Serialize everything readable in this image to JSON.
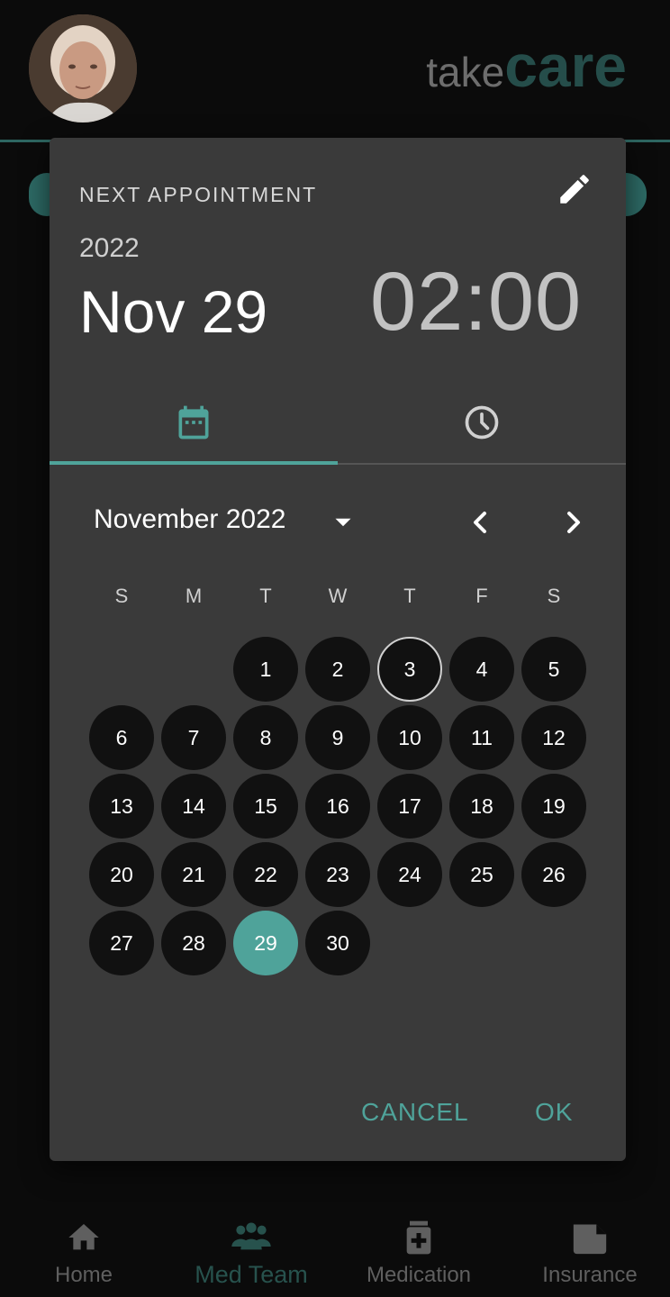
{
  "app": {
    "logo_take": "take",
    "logo_care": "care"
  },
  "dialog": {
    "title": "NEXT APPOINTMENT",
    "year": "2022",
    "date": "Nov 29",
    "time": "02:00",
    "month_label": "November 2022",
    "weekdays": [
      "S",
      "M",
      "T",
      "W",
      "T",
      "F",
      "S"
    ],
    "first_weekday_index": 2,
    "days_in_month": 30,
    "today": 3,
    "selected": 29,
    "cancel_label": "CANCEL",
    "ok_label": "OK"
  },
  "bottom_nav": {
    "items": [
      {
        "label": "Home",
        "icon": "home-icon",
        "active": false
      },
      {
        "label": "Med Team",
        "icon": "people-icon",
        "active": true
      },
      {
        "label": "Medication",
        "icon": "medication-icon",
        "active": false
      },
      {
        "label": "Insurance",
        "icon": "insurance-icon",
        "active": false
      }
    ]
  },
  "colors": {
    "accent": "#4fa39a",
    "dialog_bg": "#3a3a3a",
    "day_bg": "#111111"
  }
}
